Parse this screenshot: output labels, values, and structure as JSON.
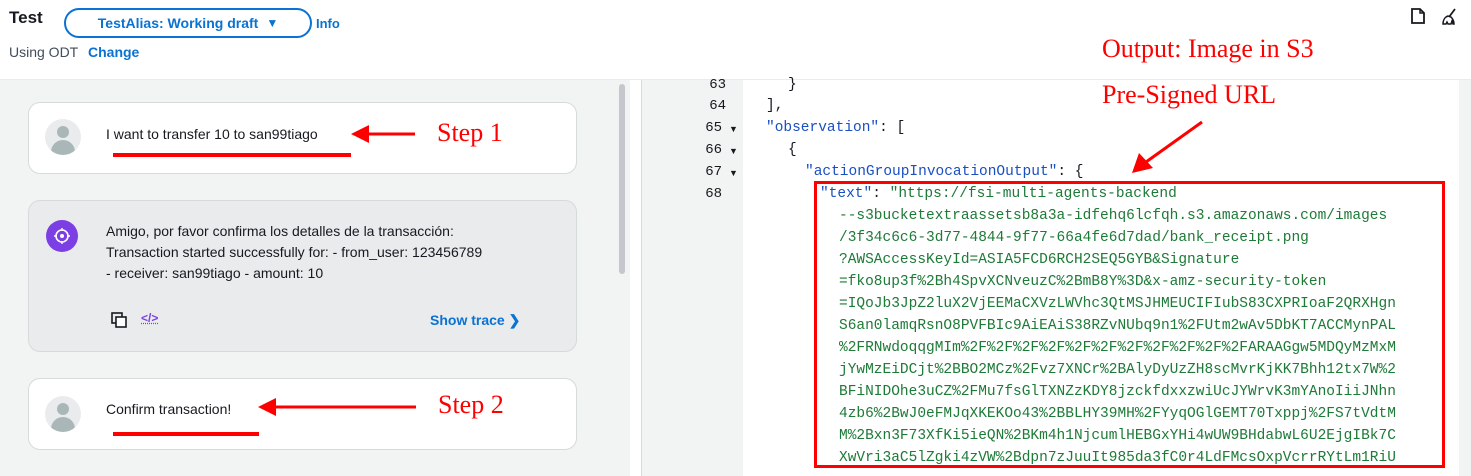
{
  "header": {
    "title": "Test",
    "alias_label": "TestAlias: Working draft",
    "info_label": "Info",
    "odt_text": "Using ODT",
    "odt_link": "Change"
  },
  "chat": {
    "messages": [
      {
        "role": "user",
        "text": "I want to transfer 10 to san99tiago"
      },
      {
        "role": "agent",
        "lines": [
          "Amigo, por favor confirma los detalles de la transacción:",
          "Transaction started successfully for: - from_user: 123456789",
          "- receiver: san99tiago - amount: 10"
        ],
        "show_trace_label": "Show trace"
      },
      {
        "role": "user",
        "text": "Confirm transaction!"
      }
    ]
  },
  "annotations": {
    "step1": "Step 1",
    "step2": "Step 2",
    "output_line1": "Output: Image in S3",
    "output_line2": "Pre-Signed URL"
  },
  "code": {
    "line_numbers": [
      "63",
      "64",
      "65",
      "66",
      "67",
      "68"
    ],
    "line_63": "}",
    "line_64": "],",
    "line_65_key": "\"observation\"",
    "line_65_rest": ": [",
    "line_66": "{",
    "line_67_key": "\"actionGroupInvocationOutput\"",
    "line_67_rest": ": {",
    "line_68_key": "\"text\"",
    "line_68_rest": ": ",
    "url_lines": [
      "\"https://fsi-multi-agents-backend",
      "--s3bucketextraassetsb8a3a-idfehq6lcfqh.s3.amazonaws.com/images",
      "/3f34c6c6-3d77-4844-9f77-66a4fe6d7dad/bank_receipt.png",
      "?AWSAccessKeyId=ASIA5FCD6RCH2SEQ5GYB&Signature",
      "=fko8up3f%2Bh4SpvXCNveuzC%2BmB8Y%3D&x-amz-security-token",
      "=IQoJb3JpZ2luX2VjEEMaCXVzLWVhc3QtMSJHMEUCIFIubS83CXPRIoaF2QRXHgn",
      "S6an0lamqRsnO8PVFBIc9AiEAiS38RZvNUbq9n1%2FUtm2wAv5DbKT7ACCMynPAL",
      "%2FRNwdoqqgMIm%2F%2F%2F%2F%2F%2F%2F%2F%2F%2F%2FARAAGgw5MDQyMzMxM",
      "jYwMzEiDCjt%2BBO2MCz%2Fvz7XNCr%2BAlyDyUzZH8scMvrKjKK7Bhh12tx7W%2",
      "BFiNIDOhe3uCZ%2FMu7fsGlTXNZzKDY8jzckfdxxzwiUcJYWrvK3mYAnoIiiJNhn",
      "4zb6%2BwJ0eFMJqXKEKOo43%2BBLHY39MH%2FYyqOGlGEMT70Txppj%2FS7tVdtM",
      "M%2Bxn3F73XfKi5ieQN%2BKm4h1NjcumlHEBGxYHi4wUW9BHdabwL6U2EjgIBk7C",
      "XwVri3aC5lZgki4zVW%2Bdpn7zJuuIt985da3fC0r4LdFMcsOxpVcrrRYtLm1RiU"
    ]
  }
}
